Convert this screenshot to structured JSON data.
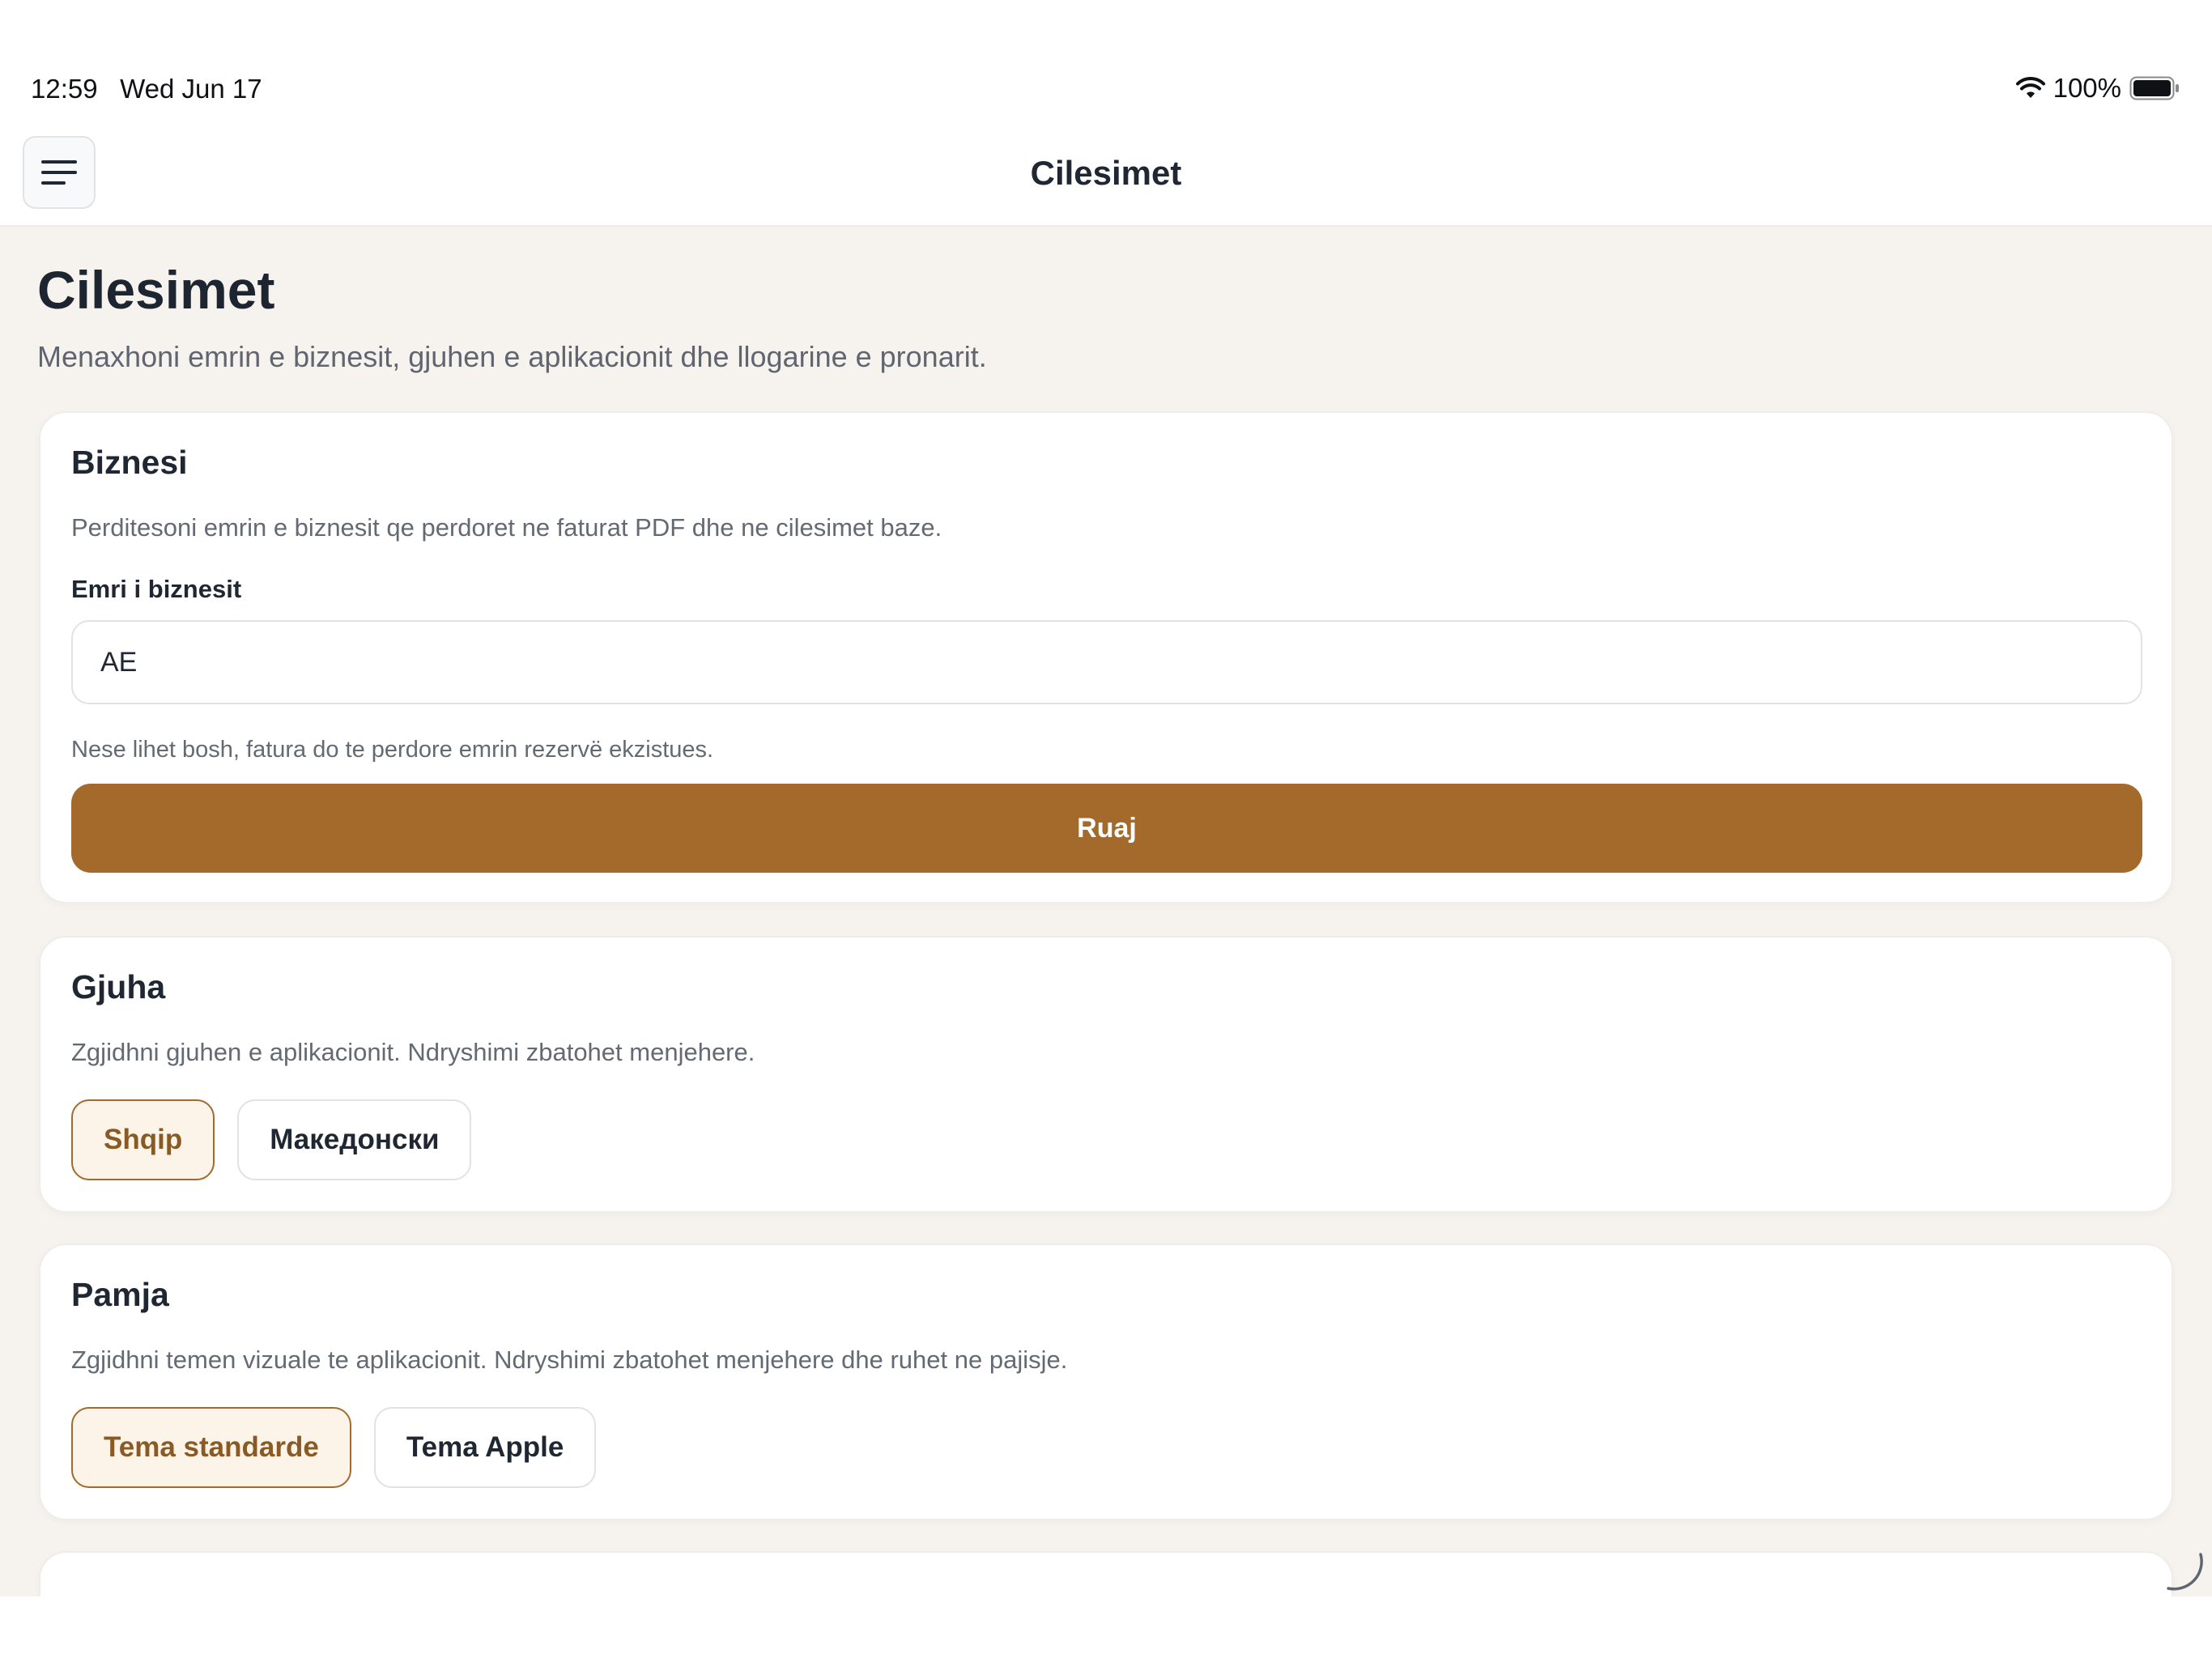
{
  "status": {
    "time": "12:59",
    "date": "Wed Jun 17",
    "battery": "100%"
  },
  "header": {
    "title": "Cilesimet"
  },
  "page": {
    "title": "Cilesimet",
    "subtitle": "Menaxhoni emrin e biznesit, gjuhen e aplikacionit dhe llogarine e pronarit."
  },
  "business": {
    "title": "Biznesi",
    "description": "Perditesoni emrin e biznesit qe perdoret ne faturat PDF dhe ne cilesimet baze.",
    "field_label": "Emri i biznesit",
    "field_value": "AE",
    "hint": "Nese lihet bosh, fatura do te perdore emrin rezervë ekzistues.",
    "save_label": "Ruaj"
  },
  "language": {
    "title": "Gjuha",
    "description": "Zgjidhni gjuhen e aplikacionit. Ndryshimi zbatohet menjehere.",
    "options": [
      "Shqip",
      "Македонски"
    ],
    "selected": "Shqip"
  },
  "appearance": {
    "title": "Pamja",
    "description": "Zgjidhni temen vizuale te aplikacionit. Ndryshimi zbatohet menjehere dhe ruhet ne pajisje.",
    "options": [
      "Tema standarde",
      "Tema Apple"
    ],
    "selected": "Tema standarde"
  },
  "colors": {
    "accent": "#a36a2c",
    "accent_bg": "#fdf4e9",
    "page_bg": "#f6f3ef"
  },
  "icons": {
    "menu": "hamburger-menu-icon",
    "wifi": "wifi-icon",
    "battery": "battery-icon",
    "loading": "spinner-icon"
  }
}
